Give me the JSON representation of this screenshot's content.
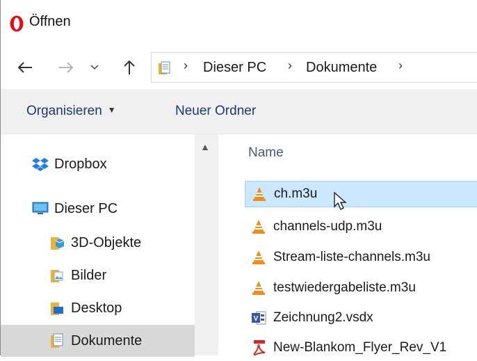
{
  "window": {
    "title": "Öffnen",
    "app_icon": "opera-logo-icon"
  },
  "nav": {
    "back_icon": "arrow-left-icon",
    "forward_icon": "arrow-right-icon",
    "recent_icon": "chevron-down-icon",
    "up_icon": "arrow-up-icon",
    "breadcrumb": [
      "Dieser PC",
      "Dokumente"
    ]
  },
  "toolbar": {
    "organize_label": "Organisieren",
    "new_folder_label": "Neuer Ordner"
  },
  "sidebar": {
    "items": [
      {
        "label": "Dropbox",
        "icon": "dropbox-icon"
      },
      {
        "label": "Dieser PC",
        "icon": "computer-icon"
      },
      {
        "label": "3D-Objekte",
        "icon": "3d-objects-folder-icon"
      },
      {
        "label": "Bilder",
        "icon": "pictures-folder-icon"
      },
      {
        "label": "Desktop",
        "icon": "desktop-folder-icon"
      },
      {
        "label": "Dokumente",
        "icon": "documents-folder-icon",
        "selected": true
      }
    ]
  },
  "filelist": {
    "column_name": "Name",
    "files": [
      {
        "name": "ch.m3u",
        "icon": "vlc-icon",
        "selected": true
      },
      {
        "name": "channels-udp.m3u",
        "icon": "vlc-icon"
      },
      {
        "name": "Stream-liste-channels.m3u",
        "icon": "vlc-icon"
      },
      {
        "name": "testwiedergabeliste.m3u",
        "icon": "vlc-icon"
      },
      {
        "name": "Zeichnung2.vsdx",
        "icon": "visio-icon"
      },
      {
        "name": "New-Blankom_Flyer_Rev_V1",
        "icon": "pdf-icon"
      }
    ]
  },
  "colors": {
    "selection_bg": "#cce8ff",
    "selection_border": "#99d1ff",
    "toolbar_bg": "#f0f0f0",
    "nav_selected_bg": "#d9d9d9",
    "opera_red": "#e0101a",
    "vlc_orange": "#f28c1b"
  }
}
